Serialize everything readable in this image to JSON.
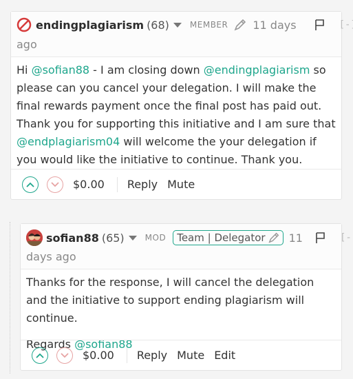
{
  "comments": [
    {
      "author": "endingplagiarism",
      "reputation": "(68)",
      "role": "MEMBER",
      "time_line1": "11 days",
      "time_line2": "ago",
      "collapse": "[-]",
      "body": {
        "p1_a": "Hi ",
        "p1_mention1": "@sofian88",
        "p1_b": " - I am closing down ",
        "p1_mention2": "@endingplagiarism",
        "p1_c": " so please can you cancel your delegation. I will make the final rewards payment once the final post has paid out. Thank you for supporting this initiative and I am sure that ",
        "p1_mention3": "@endplagiarism04",
        "p1_d": " will welcome the your delegation if you would like the initiative to continue. Thank you."
      },
      "payout": "$0.00",
      "actions": {
        "reply": "Reply",
        "mute": "Mute"
      }
    },
    {
      "author": "sofian88",
      "reputation": "(65)",
      "role": "MOD",
      "badge": "Team | Delegator",
      "time_line1": "11",
      "time_line2": "days ago",
      "collapse": "[-]",
      "body": {
        "p1": "Thanks for the response, I will cancel the delegation and the initiative to support ending plagiarism will continue.",
        "p2_a": "Regards ",
        "p2_mention": "@sofian88"
      },
      "payout": "$0.00",
      "actions": {
        "reply": "Reply",
        "mute": "Mute",
        "edit": "Edit"
      }
    }
  ],
  "icons": {
    "logo": "no-sign-icon",
    "avatar": "avatar",
    "pencil": "pencil-icon",
    "flag": "flag-icon",
    "upvote": "chevron-up-icon",
    "downvote": "chevron-down-icon"
  },
  "colors": {
    "accent": "#1ea68c",
    "downvote": "#e7a3a3",
    "logo_red": "#d63a3a"
  }
}
